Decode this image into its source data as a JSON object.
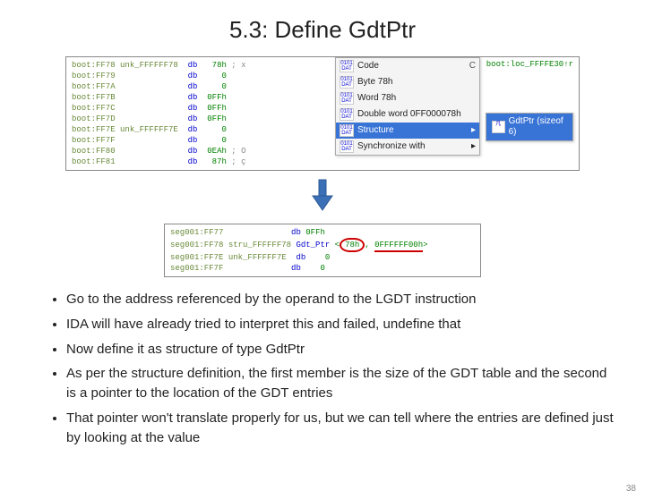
{
  "title": "5.3: Define GdtPtr",
  "page_number": "38",
  "ida_before": {
    "xref": "; DATA XREF: boot:loc_FFFFE30↑r",
    "rows": [
      {
        "seg": "boot:FF78",
        "name": "unk_FFFFFF78",
        "mnm": "db",
        "val": "78h",
        "cmt": "; x"
      },
      {
        "seg": "boot:FF79",
        "name": "",
        "mnm": "db",
        "val": "0",
        "cmt": ""
      },
      {
        "seg": "boot:FF7A",
        "name": "",
        "mnm": "db",
        "val": "0",
        "cmt": ""
      },
      {
        "seg": "boot:FF7B",
        "name": "",
        "mnm": "db",
        "val": "0FFh",
        "cmt": ""
      },
      {
        "seg": "boot:FF7C",
        "name": "",
        "mnm": "db",
        "val": "0FFh",
        "cmt": ""
      },
      {
        "seg": "boot:FF7D",
        "name": "",
        "mnm": "db",
        "val": "0FFh",
        "cmt": ""
      },
      {
        "seg": "boot:FF7E",
        "name": "unk_FFFFFF7E",
        "mnm": "db",
        "val": "0",
        "cmt": ""
      },
      {
        "seg": "boot:FF7F",
        "name": "",
        "mnm": "db",
        "val": "0",
        "cmt": ""
      },
      {
        "seg": "boot:FF80",
        "name": "",
        "mnm": "db",
        "val": "0EAh",
        "cmt": "; O"
      },
      {
        "seg": "boot:FF81",
        "name": "",
        "mnm": "db",
        "val": "87h",
        "cmt": "; ç"
      }
    ]
  },
  "context_menu": {
    "items": [
      {
        "label": "Code",
        "shortcut": "C"
      },
      {
        "label": "Byte 78h"
      },
      {
        "label": "Word 78h"
      },
      {
        "label": "Double word 0FF000078h"
      },
      {
        "label": "Structure",
        "submenu": true,
        "selected": true
      },
      {
        "label": "Synchronize with",
        "submenu": true
      }
    ]
  },
  "submenu": {
    "label": "GdtPtr (sizeof 6)"
  },
  "ida_after": {
    "rows": [
      {
        "seg": "seg001:FF77",
        "name": "",
        "mnm": "db",
        "val": "0FFh"
      },
      {
        "seg": "seg001:FF78",
        "name": "stru_FFFFFF78",
        "mnm": "Gdt_Ptr",
        "val": "<78h, 0FFFFFF00h>"
      },
      {
        "seg": "seg001:FF7E",
        "name": "unk_FFFFFF7E",
        "mnm": "db",
        "val": "0"
      },
      {
        "seg": "seg001:FF7F",
        "name": "",
        "mnm": "db",
        "val": "0"
      }
    ]
  },
  "bullets": [
    "Go to the address referenced by the operand to the LGDT instruction",
    "IDA will have already tried to interpret this and failed, undefine that",
    "Now define it as structure of type GdtPtr",
    "As per the structure definition, the first member is the size of the GDT table and the second is a pointer to the location of the GDT entries",
    "That pointer won't translate properly for us, but we can tell where the entries are defined just by looking at the value"
  ]
}
